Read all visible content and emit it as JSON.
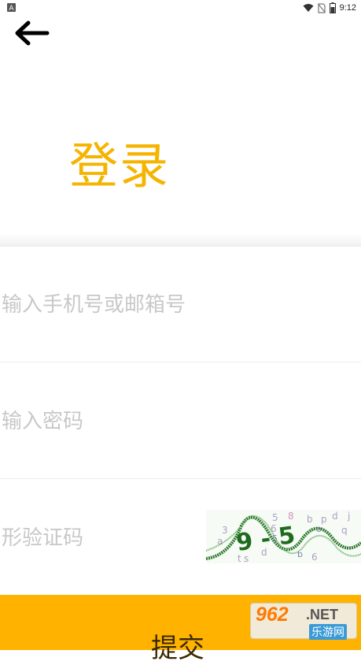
{
  "status_bar": {
    "time": "9:12",
    "icons": [
      "notification-a-icon",
      "wifi-icon",
      "no-sim-icon",
      "battery-icon"
    ]
  },
  "nav": {
    "back_icon": "arrow-left-icon"
  },
  "title": "登录",
  "form": {
    "account_placeholder": "输入手机号或邮箱号",
    "password_placeholder": "输入密码",
    "captcha_placeholder": "形验证码",
    "captcha_text": "9 - 5"
  },
  "submit_label": "提交",
  "watermark": {
    "top": "962",
    "net": ".NET",
    "bottom": "乐游网"
  },
  "colors": {
    "accent": "#FFB300",
    "title": "#F5B400",
    "placeholder": "#C8C8C8"
  }
}
